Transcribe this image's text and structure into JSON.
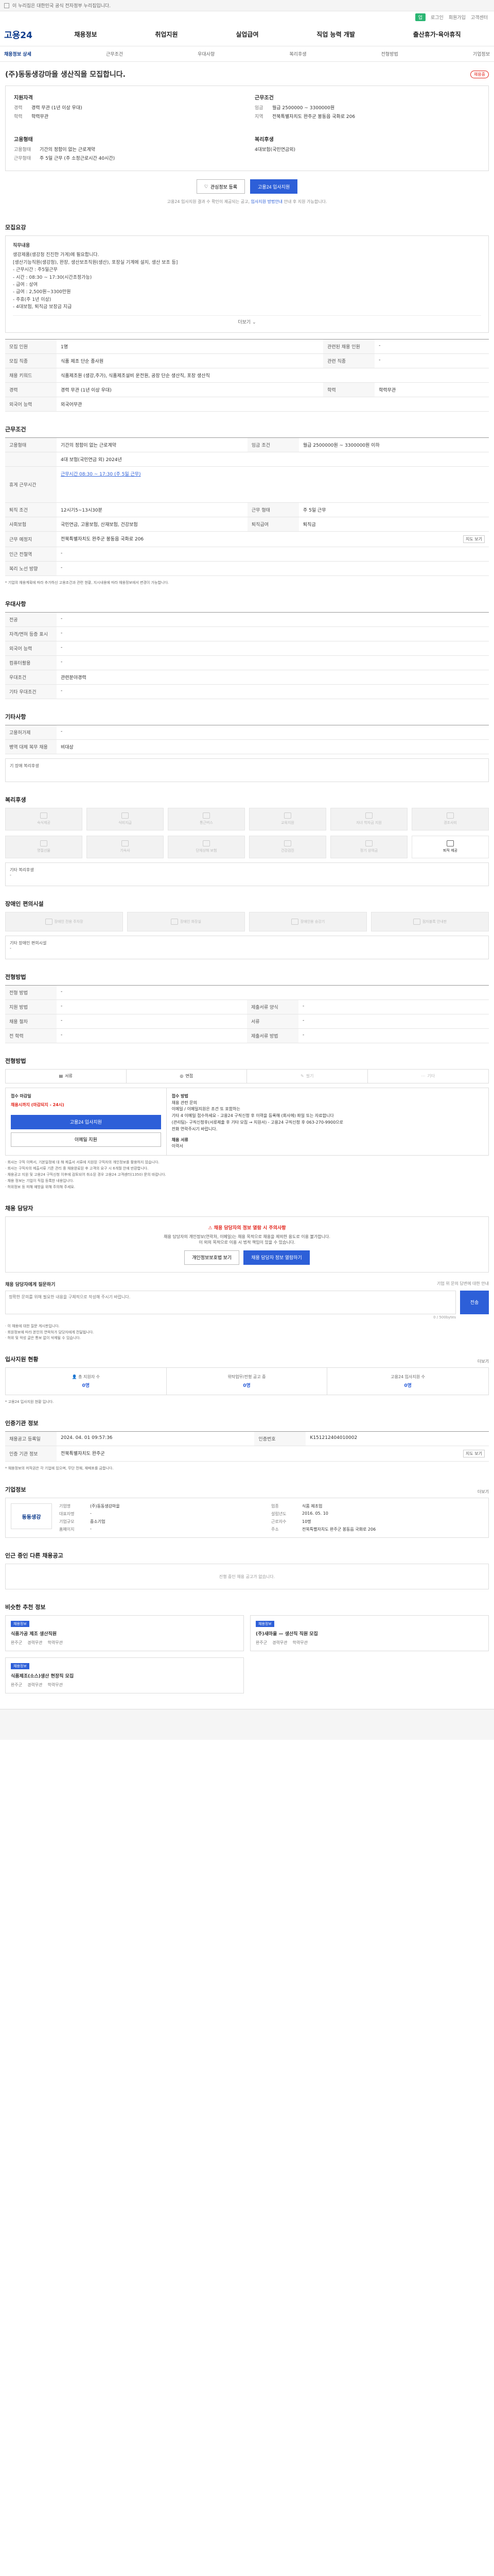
{
  "topbar": {
    "text": "이 누리집은 대한민국 공식 전자정부 누리집입니다."
  },
  "utilbar": {
    "items": [
      "로그인",
      "회원가입",
      "고객센터"
    ],
    "green": "업"
  },
  "header": {
    "logo": "고용24",
    "gnb": [
      "채용정보",
      "취업지원",
      "실업급여",
      "직업 능력 개발",
      "출산휴가·육아휴직"
    ]
  },
  "subnav": [
    "채용정보 상세",
    "근무조건",
    "우대사항",
    "복리후생",
    "전형방법",
    "기업정보"
  ],
  "job": {
    "title": "(주)동동생강마을 생산직을 모집합니다.",
    "status": "채용중",
    "summary": {
      "company": {
        "label": "지원자격",
        "rows": [
          {
            "k": "경력",
            "v": "경력 무관 (1년 이상 우대)"
          },
          {
            "k": "학력",
            "v": "학력무관"
          }
        ]
      },
      "work": {
        "label": "근무조건",
        "rows": [
          {
            "k": "임금",
            "v": "월급 2500000 ~ 3300000원"
          },
          {
            "k": "지역",
            "v": "전북특별자치도 완주군 봉동읍 국화로 206"
          }
        ]
      },
      "type": {
        "label": "고용형태",
        "rows": [
          {
            "k": "고용형태",
            "v": "기간의 정함이 없는 근로계약"
          },
          {
            "k": "근무형태",
            "v": "주 5일 근무 (주 소정근로시간 40시간)"
          }
        ]
      },
      "welfare": {
        "label": "복리후생",
        "rows": [
          {
            "k": "",
            "v": "4대보험(국민연금외)"
          }
        ]
      }
    },
    "btn_save": "관심정보 등록",
    "btn_apply": "고용24 입사지원",
    "notice_pre": "고용24 입사지원 결과 수 확인이 제공되는 공고,",
    "notice_link": "입사지원 방법안내",
    "notice_post": "안내 후 지원 가능합니다."
  },
  "recruit": {
    "title": "모집요강",
    "job_label": "직무내용",
    "content": [
      "생강제품(생강청 진진한 가게)에 필요합니다.",
      "[생산기능직원(생강청), 완장, 생산보조직원(생산), 포장실 기계에 설치, 생산 보조 등]",
      "- 근무시간 : 주5일근무",
      "- 시간 : 08:30 ~ 17:30(시간조정가능)",
      "- 급여 : 상여",
      "- 급여 : 2,500원~3300만원",
      "- 주휴(주 1년 이상)",
      "- 4대보험, 퇴직금 보장금 지급"
    ],
    "more": "더보기",
    "rows": [
      {
        "k": "모집 인원",
        "v": "1명",
        "k2": "관련된 채용 인원",
        "v2": "-"
      },
      {
        "k": "모집 직종",
        "v": "식품 제조 단순 종사원",
        "k2": "관련 직종",
        "v2": "-"
      },
      {
        "k": "채용 키워드",
        "v": "식품제조원 (생강,주가), 식품제조설비 운전원, 공장 단순 생산직, 포장 생산직",
        "k2": "",
        "v2": ""
      },
      {
        "k": "경력",
        "v": "경력 무관 (1년 이상 우대)",
        "k2": "학력",
        "v2": "학력무관"
      },
      {
        "k": "외국어 능력",
        "v": "외국어무관",
        "k2": "",
        "v2": ""
      }
    ]
  },
  "workcond": {
    "title": "근무조건",
    "rows1": [
      {
        "k": "고용형태",
        "v": "기간의 정함이 없는 근로계약",
        "k2": "임금 조건",
        "v2": "월급 2500000원 ~ 3300000원 이하"
      }
    ],
    "insurance": "4대 보험(국민연금 외) 2024년",
    "time_title": "휴게 근무시간",
    "time_line": "근무시간 08:30 ~ 17:30 (주 5일 근무)",
    "rows2": [
      {
        "k": "퇴직 조건",
        "v": "12시기5~13시30분",
        "k2": "근무 형태",
        "v2": "주 5일 근무"
      },
      {
        "k": "사회보험",
        "v": "국민연금, 고용보험, 산재보험, 건강보험",
        "k2": "퇴직급여",
        "v2": "퇴직금"
      },
      {
        "k": "근무 예정지",
        "v": "전북특별자치도 완주군 봉동읍 국화로 206",
        "k2": "",
        "v2": ""
      },
      {
        "k": "인근 전철역",
        "v": "-",
        "k2": "",
        "v2": ""
      },
      {
        "k": "복리 노선 방향",
        "v": "-",
        "k2": "",
        "v2": ""
      }
    ],
    "map_btn": "지도 보기",
    "footnote": "* 기업의 채용계획에 따라 추가하신 고용조건과 관련 현황, 지시내용에 따라 채용정보에서 변경이 가능합니다."
  },
  "pref": {
    "title": "우대사항",
    "rows": [
      {
        "k": "전공",
        "v": "-"
      },
      {
        "k": "자격/면허 등증 표시",
        "v": "-"
      },
      {
        "k": "외국어 능력",
        "v": "-"
      },
      {
        "k": "컴퓨터활용",
        "v": "-"
      },
      {
        "k": "우대조건",
        "v": "관련분야경력"
      },
      {
        "k": "기타 우대조건",
        "v": "-"
      }
    ]
  },
  "etc": {
    "title": "기타사항",
    "rows": [
      {
        "k": "고용허가제",
        "v": "-"
      },
      {
        "k": "병역 대체 복무 채용",
        "v": "비대상"
      }
    ],
    "box": "기 장애 복리후생"
  },
  "welfare": {
    "title": "복리후생",
    "items": [
      "숙식제공",
      "식비지급",
      "통근버스",
      "교육지원",
      "자녀 학자금 지원",
      "경조사비",
      "명절선물",
      "기숙사",
      "단체상해 보험",
      "건강검진",
      "정기 상여금",
      "퇴직 제공"
    ],
    "on_index": 11,
    "box_label": "기타 복리후생",
    "box_val": "-"
  },
  "disability": {
    "title": "장애인 편의시설",
    "items": [
      "장애인 전용 주차장",
      "장애인 화장실",
      "장애인용 승강기",
      "점자블록 안내판"
    ],
    "box_label": "기타 장애인 편의시설",
    "box_val": "-"
  },
  "method": {
    "title": "전형방법",
    "rows": [
      {
        "k": "전형 방법",
        "v": "-",
        "k2": "",
        "v2": ""
      },
      {
        "k": "지원 방법",
        "v": "-",
        "k2": "제출서류 양식",
        "v2": "-"
      },
      {
        "k": "채용 절차",
        "v": "-",
        "k2": "서류",
        "v2": "-"
      },
      {
        "k": "전 학력",
        "v": "-",
        "k2": "제출서류 방법",
        "v2": "-"
      }
    ]
  },
  "apply": {
    "title": "전형방법",
    "tabs": [
      "서류",
      "면접",
      "필기",
      "기타"
    ],
    "on_tabs": [
      0,
      1
    ],
    "left_title": "접수 마감일",
    "left_red": "채용시까지 (마감되지 - 24시)",
    "left_btn": "고용24 입사지원",
    "left_btn2": "이메일 지원",
    "right_title": "접수 방법",
    "right_lines": [
      "채용 관련 문의",
      "이메일 / 이메일지원은 조건 또 포함하는",
      "기타 4 이메일 접수하세요 - 고용24 구직신청 후 이력을 등록해 (회사에) 파일 또는 자료합니다",
      "(관리팀)- 구직신청후(서류제출 후 기타 모집 → 지원서) - 고용24 구직신청 후 063-270-9900으로",
      "전화 연락주시기 바랍니다."
    ],
    "right_extra": "채용 서류",
    "right_extra2": "이력서",
    "bullets": [
      "· 회사는 구직 이력서, 기본일정에 대 해 제출서 서류에 지원된 구직자의 개인정보를 활용하지 않습니다.",
      "· 회사는 구직자의 제출서류 기준 관리 중 채용완료된 후 고객의 요구 시 6개월 안에 반환합니다.",
      "· 채용공고 지원 및 고용24 구직신청 이후에 검토되어 취소된 경우 고용24 고객센터(1350) 문의 바랍니다.",
      "· 채용 정보는 기업이 직접 등록한 내용입니다.",
      "· 허위정보 등 피해 예방을 위해 주의해 주세요."
    ]
  },
  "report": {
    "title": "채용 담당자",
    "warn_title": "채용 담당자의 정보 열람 시 주의사항",
    "warn_lines": [
      "채용 담당자의 개인정보(연락처, 이메일)는 채용 목적으로 채용을 제외한 용도로 이용 불가합니다.",
      "이 외의 목적으로 이용 시 법적 책임이 있을 수 있습니다."
    ],
    "btn1": "개인정보보호법 보기",
    "btn2": "채용 담당자 정보 열람하기",
    "inq_title": "채용 담당자에게 질문하기",
    "inq_hint": "기업 위 문의 답변에 대한 안내",
    "inq_placeholder": "정확한 문의를 위해 필요한 내용을 구체적으로 작성해 주시기 바랍니다.",
    "inq_count": "0 / 500bytes",
    "inq_btn": "전송",
    "inq_notes": [
      "· 이 채용에 대한 질문 게시판입니다.",
      "· 회원정보에 따라 본인의 연락처가 담당자에게 전달됩니다.",
      "· 허위 및 악성 글은 통보 없이 삭제될 수 있습니다."
    ]
  },
  "stats": {
    "title": "입사지원 현황",
    "more": "더보기",
    "items": [
      {
        "label": "총 지원자 수",
        "val": "0명"
      },
      {
        "label": "위탁업무/전형 공고 중",
        "val": "0명"
      },
      {
        "label": "고용24 입사지원 수",
        "val": "0명"
      }
    ],
    "note": "* 고용24 입사지원 현황 입니다."
  },
  "regist": {
    "title": "인증기관 정보",
    "rows": [
      {
        "k": "채용공고 등록일",
        "v": "2024. 04. 01 09:57:36",
        "k2": "인증번호",
        "v2": "K151212404010002"
      },
      {
        "k": "인증 기관 정보",
        "v": "전북특별자치도 완주군",
        "k2": "",
        "v2": ""
      }
    ],
    "btn": "지도 보기",
    "note": "* 채용정보의 저작권은 각 기업에 있으며, 무단 전재, 재배포를 금합니다."
  },
  "company": {
    "title": "기업정보",
    "more": "더보기",
    "logo": "동동생강",
    "rows": [
      {
        "k": "기업명",
        "v": "(주)동동생강마을",
        "k2": "업종",
        "v2": "식품 제조업"
      },
      {
        "k": "대표자명",
        "v": "-",
        "k2": "설립년도",
        "v2": "2016. 05. 10"
      },
      {
        "k": "기업규모",
        "v": "중소기업",
        "k2": "근로자수",
        "v2": "10명"
      },
      {
        "k": "홈페이지",
        "v": "-",
        "k2": "주소",
        "v2": "전북특별자치도 완주군 봉동읍 국화로 206"
      }
    ]
  },
  "other": {
    "title": "인근 중인 다른 채용공고",
    "empty": "진행 중인 채용 공고가 없습니다."
  },
  "recommend": {
    "title": "비슷한 추천 정보",
    "cards": [
      {
        "tag": "채용정보",
        "name": "식품가공 제조 생산직원",
        "meta": [
          "완주군",
          "경력무관",
          "학력무관"
        ]
      },
      {
        "tag": "채용정보",
        "name": "(주)새마을 — 생산직 직원 모집",
        "meta": [
          "완주군",
          "경력무관",
          "학력무관"
        ]
      },
      {
        "tag": "채용정보",
        "name": "식품제조(소스)생산 현장직 모집",
        "meta": [
          "완주군",
          "경력무관",
          "학력무관"
        ]
      }
    ]
  }
}
